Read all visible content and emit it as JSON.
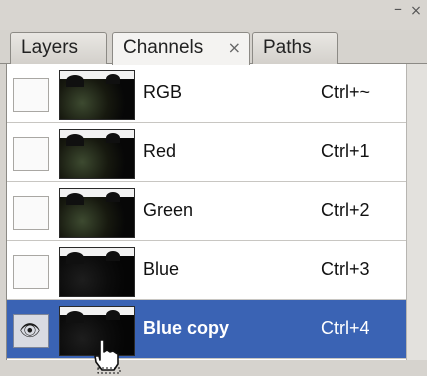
{
  "window": {
    "minimize_icon": "minimize-icon",
    "close_icon": "close-icon",
    "minimize_glyph": "–",
    "close_glyph": "×"
  },
  "tabs": [
    {
      "label": "Layers",
      "active": false
    },
    {
      "label": "Channels",
      "active": true,
      "close_glyph": "×"
    },
    {
      "label": "Paths",
      "active": false
    }
  ],
  "panel_menu_glyph": "▾≡",
  "channels": [
    {
      "name": "RGB",
      "shortcut": "Ctrl+~",
      "visible": false,
      "selected": false
    },
    {
      "name": "Red",
      "shortcut": "Ctrl+1",
      "visible": false,
      "selected": false
    },
    {
      "name": "Green",
      "shortcut": "Ctrl+2",
      "visible": false,
      "selected": false
    },
    {
      "name": "Blue",
      "shortcut": "Ctrl+3",
      "visible": false,
      "selected": false
    },
    {
      "name": "Blue copy",
      "shortcut": "Ctrl+4",
      "visible": true,
      "selected": true
    }
  ],
  "colors": {
    "selection": "#3a63b4",
    "panel_bg": "#d6d3ce"
  },
  "icons": {
    "eye": "eye-icon",
    "cursor": "hand-cursor-icon"
  }
}
